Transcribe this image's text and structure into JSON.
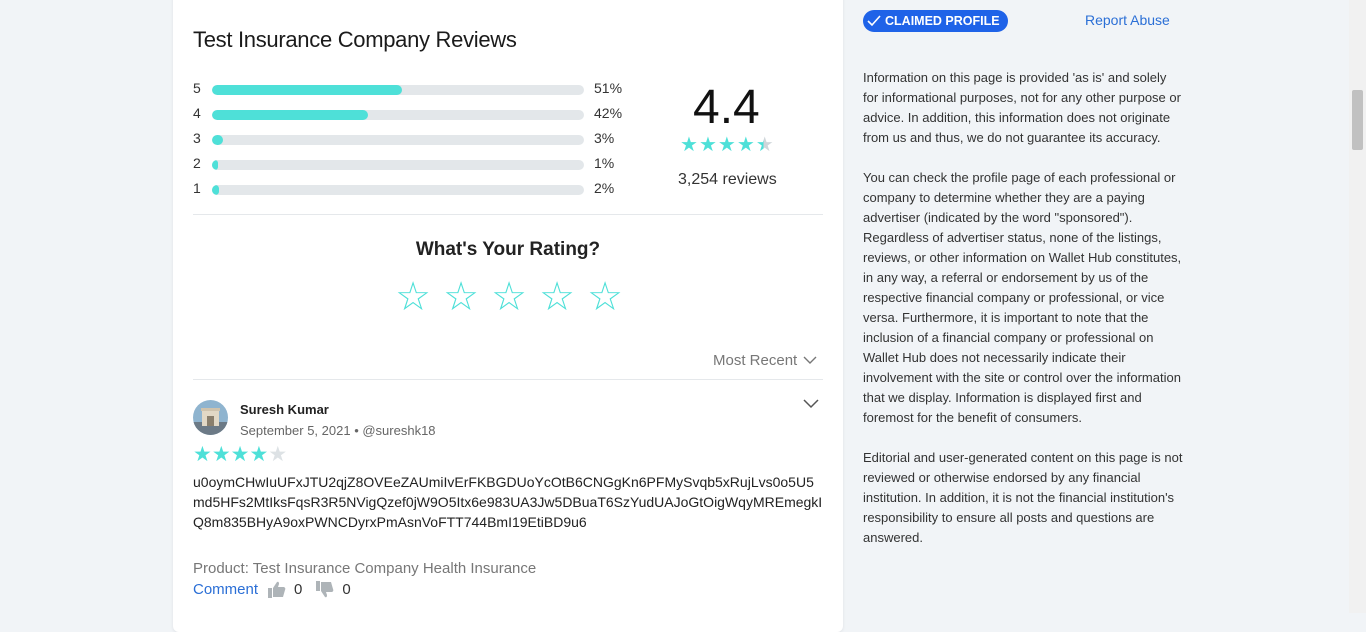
{
  "review_card": {
    "title": "Test Insurance Company Reviews",
    "distribution": [
      {
        "stars": "5",
        "percent_label": "51%",
        "fill": 0.51
      },
      {
        "stars": "4",
        "percent_label": "42%",
        "fill": 0.42
      },
      {
        "stars": "3",
        "percent_label": "3%",
        "fill": 0.03
      },
      {
        "stars": "2",
        "percent_label": "1%",
        "fill": 0.01
      },
      {
        "stars": "1",
        "percent_label": "2%",
        "fill": 0.02
      }
    ],
    "average_rating": "4.4",
    "average_stars": 4.4,
    "review_count": "3,254 reviews",
    "rating_prompt": "What's Your Rating?",
    "rating_stars": 5,
    "sort_label": "Most Recent",
    "accent_color": "#4ee0d8"
  },
  "review": {
    "author": "Suresh Kumar",
    "date": "September 5, 2021",
    "handle": "@sureshk18",
    "stars": 4,
    "text": "u0oymCHwIuUFxJTU2qjZ8OVEeZAUmiIvErFKBGDUoYcOtB6CNGgKn6PFMySvqb5xRujLvs0o5U5md5HFs2MtIksFqsR3R5NVigQzef0jW9O5Itx6e983UA3Jw5DBuaT6SzYudUAJoGtOigWqyMREmegkIQ8m835BHyA9oxPWNCDyrxPmAsnVoFTT744BmI19EtiBD9u6",
    "product": "Product: Test Insurance Company Health Insurance",
    "comment_label": "Comment",
    "likes": "0",
    "dislikes": "0"
  },
  "sidebar": {
    "claimed_label": "CLAIMED PROFILE",
    "report_label": "Report Abuse",
    "brand_color": "#1f63e8",
    "paragraphs": [
      "Information on this page is provided 'as is' and solely for informational purposes, not for any other purpose or advice. In addition, this information does not originate from us and thus, we do not guarantee its accuracy.",
      "You can check the profile page of each professional or company to determine whether they are a paying advertiser (indicated by the word \"sponsored\"). Regardless of advertiser status, none of the listings, reviews, or other information on Wallet Hub constitutes, in any way, a referral or endorsement by us of the respective financial company or professional, or vice versa. Furthermore, it is important to note that the inclusion of a financial company or professional on Wallet Hub does not necessarily indicate their involvement with the site or control over the information that we display. Information is displayed first and foremost for the benefit of consumers.",
      "Editorial and user-generated content on this page is not reviewed or otherwise endorsed by any financial institution. In addition, it is not the financial institution's responsibility to ensure all posts and questions are answered."
    ]
  }
}
